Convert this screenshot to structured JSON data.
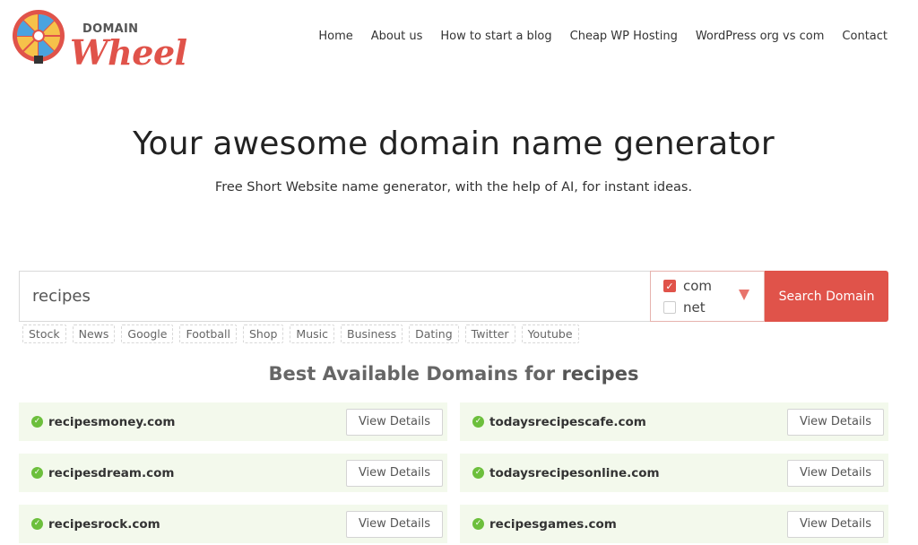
{
  "logo": {
    "small_text": "DOMAIN",
    "big_text": "Wheel"
  },
  "nav": {
    "items": [
      {
        "label": "Home"
      },
      {
        "label": "About us"
      },
      {
        "label": "How to start a blog"
      },
      {
        "label": "Cheap WP Hosting"
      },
      {
        "label": "WordPress org vs com"
      },
      {
        "label": "Contact"
      }
    ]
  },
  "hero": {
    "title": "Your awesome domain name generator",
    "subtitle": "Free Short Website name generator, with the help of AI, for instant ideas."
  },
  "search": {
    "value": "recipes",
    "tlds": [
      {
        "label": "com",
        "checked": true
      },
      {
        "label": "net",
        "checked": false
      }
    ],
    "button_label": "Search Domain"
  },
  "tags": [
    "Stock",
    "News",
    "Google",
    "Football",
    "Shop",
    "Music",
    "Business",
    "Dating",
    "Twitter",
    "Youtube"
  ],
  "results": {
    "title_prefix": "Best Available Domains for",
    "keyword": "recipes",
    "button_label": "View Details",
    "domains": [
      "recipesmoney.com",
      "todaysrecipescafe.com",
      "recipesdream.com",
      "todaysrecipesonline.com",
      "recipesrock.com",
      "recipesgames.com"
    ]
  },
  "colors": {
    "accent": "#e0534a",
    "available": "#6cbf3c",
    "card_bg": "#f3f9ec"
  },
  "icons": {
    "tld_dropdown": "triangle-down-icon",
    "available": "check-circle-icon",
    "logo": "wheel-icon"
  }
}
